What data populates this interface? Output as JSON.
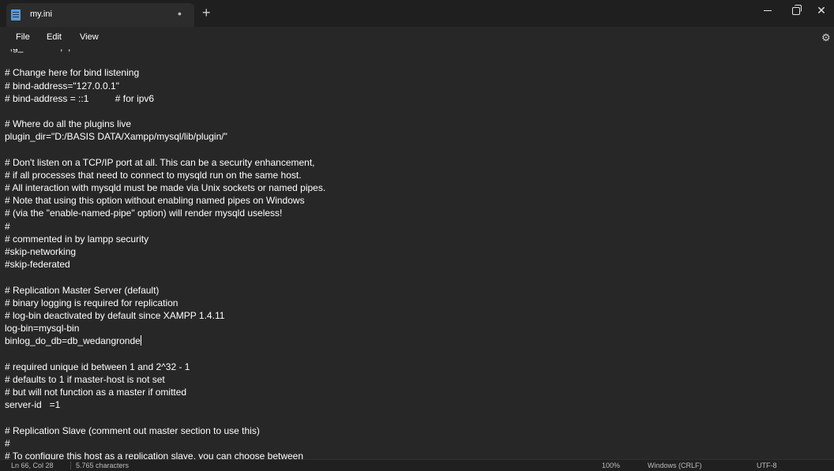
{
  "tab": {
    "title": "my.ini",
    "modified_indicator": "•",
    "new_tab_label": "+"
  },
  "window_controls": {
    "minimize_icon": "minimize-icon",
    "maximize_icon": "restore-icon",
    "close_label": "✕"
  },
  "menu": {
    "file": "File",
    "edit": "Edit",
    "view": "View",
    "settings_icon": "⚙"
  },
  "editor": {
    "lines": [
      "  ,g_              ,  ,                      ",
      "",
      "# Change here for bind listening",
      "# bind-address=\"127.0.0.1\"",
      "# bind-address = ::1          # for ipv6",
      "",
      "# Where do all the plugins live",
      "plugin_dir=\"D:/BASIS DATA/Xampp/mysql/lib/plugin/\"",
      "",
      "# Don't listen on a TCP/IP port at all. This can be a security enhancement,",
      "# if all processes that need to connect to mysqld run on the same host.",
      "# All interaction with mysqld must be made via Unix sockets or named pipes.",
      "# Note that using this option without enabling named pipes on Windows",
      "# (via the \"enable-named-pipe\" option) will render mysqld useless!",
      "#",
      "# commented in by lampp security",
      "#skip-networking",
      "#skip-federated",
      "",
      "# Replication Master Server (default)",
      "# binary logging is required for replication",
      "# log-bin deactivated by default since XAMPP 1.4.11",
      "log-bin=mysql-bin",
      "binlog_do_db=db_wedangronde",
      "",
      "# required unique id between 1 and 2^32 - 1",
      "# defaults to 1 if master-host is not set",
      "# but will not function as a master if omitted",
      "server-id   =1",
      "",
      "# Replication Slave (comment out master section to use this)",
      "#",
      "# To configure this host as a replication slave, you can choose between"
    ]
  },
  "status": {
    "position": "Ln 66, Col 28",
    "characters": "5.765 characters",
    "zoom": "100%",
    "line_ending": "Windows (CRLF)",
    "encoding": "UTF-8"
  }
}
